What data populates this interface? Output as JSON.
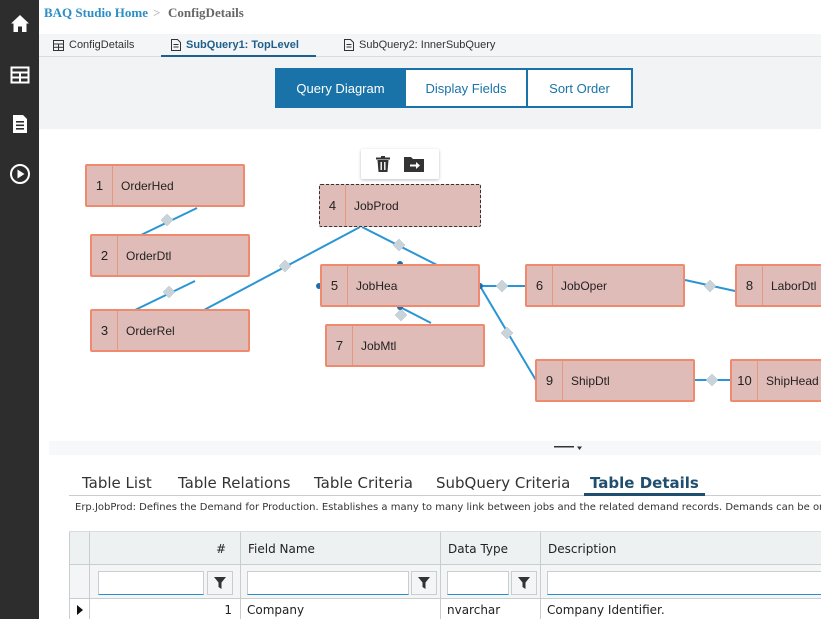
{
  "rail": {
    "items": [
      {
        "name": "home-icon"
      },
      {
        "name": "grid-table-icon"
      },
      {
        "name": "document-icon"
      },
      {
        "name": "play-circle-icon"
      }
    ]
  },
  "breadcrumb": {
    "home": "BAQ Studio Home",
    "separator": ">",
    "current": "ConfigDetails"
  },
  "query_tabs": [
    {
      "label": "ConfigDetails",
      "icon": "table-icon",
      "active": false
    },
    {
      "label": "SubQuery1: TopLevel",
      "icon": "document-icon",
      "active": true
    },
    {
      "label": "SubQuery2: InnerSubQuery",
      "icon": "document-icon",
      "active": false
    }
  ],
  "view_buttons": {
    "diagram": "Query Diagram",
    "fields": "Display Fields",
    "sort": "Sort Order"
  },
  "diagram": {
    "nodes": [
      {
        "num": "1",
        "name": "OrderHed"
      },
      {
        "num": "2",
        "name": "OrderDtl"
      },
      {
        "num": "3",
        "name": "OrderRel"
      },
      {
        "num": "4",
        "name": "JobProd"
      },
      {
        "num": "5",
        "name": "JobHead"
      },
      {
        "num": "6",
        "name": "JobOper"
      },
      {
        "num": "7",
        "name": "JobMtl"
      },
      {
        "num": "8",
        "name": "LaborDtl"
      },
      {
        "num": "9",
        "name": "ShipDtl"
      },
      {
        "num": "10",
        "name": "ShipHead"
      }
    ],
    "tools": {
      "delete": "trash-icon",
      "move": "folder-move-icon"
    }
  },
  "bottom_tabs": [
    {
      "label": "Table List",
      "active": false
    },
    {
      "label": "Table Relations",
      "active": false
    },
    {
      "label": "Table Criteria",
      "active": false
    },
    {
      "label": "SubQuery Criteria",
      "active": false
    },
    {
      "label": "Table Details",
      "active": true
    }
  ],
  "table_description": "Erp.JobProd: Defines the Demand for Production. Establishes a many to many link between jobs and the related demand records. Demands can be ord",
  "grid": {
    "columns": [
      "#",
      "Field Name",
      "Data Type",
      "Description"
    ],
    "rows": [
      {
        "num": "1",
        "field": "Company",
        "type": "nvarchar",
        "desc": "Company Identifier."
      }
    ]
  },
  "colors": {
    "accent": "#1a73a8",
    "node_fill": "#e0bcb8",
    "node_border": "#ef8a6e",
    "link": "#2a95d5",
    "link_marker": "#c9d4da"
  }
}
